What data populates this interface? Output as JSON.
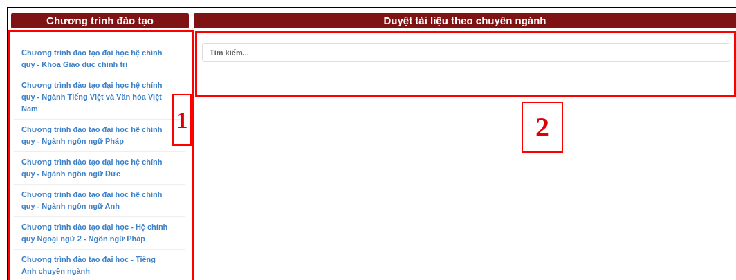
{
  "left_panel": {
    "title": "Chương trình đào tạo",
    "items": [
      {
        "label": "Chương trình đào tạo đại học hệ chính quy - Khoa Giáo dục chính trị"
      },
      {
        "label": "Chương trình đào tạo đại học hệ chính quy - Ngành Tiếng Việt và Văn hóa Việt Nam"
      },
      {
        "label": "Chương trình đào tạo đại học hệ chính quy - Ngành ngôn ngữ Pháp"
      },
      {
        "label": "Chương trình đào tạo đại học hệ chính quy - Ngành ngôn ngữ Đức"
      },
      {
        "label": "Chương trình đào tạo đại học hệ chính quy - Ngành ngôn ngữ Anh"
      },
      {
        "label": "Chương trình đào tạo đại học - Hệ chính quy Ngoại ngữ 2 - Ngôn ngữ Pháp"
      },
      {
        "label": "Chương trình đào tạo đại học - Tiếng Anh chuyên ngành"
      }
    ]
  },
  "right_panel": {
    "title": "Duyệt tài liệu theo chuyên ngành",
    "search": {
      "placeholder": "Tìm kiếm..."
    }
  },
  "callouts": [
    {
      "label": "1"
    },
    {
      "label": "2"
    }
  ]
}
